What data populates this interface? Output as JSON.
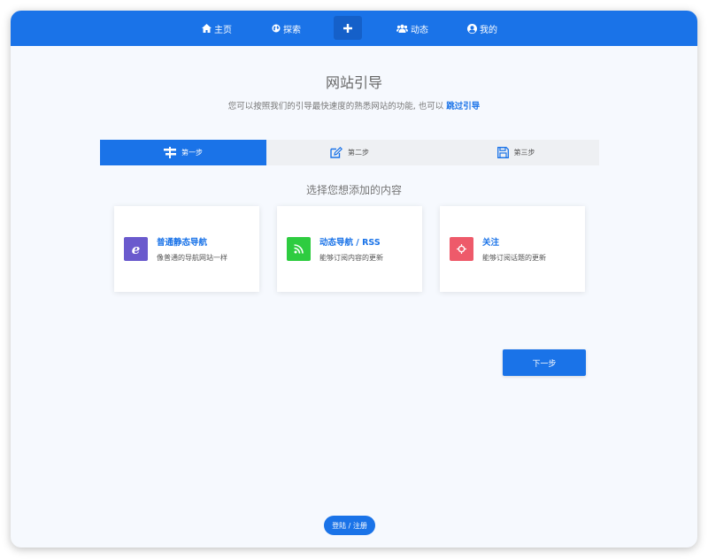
{
  "colors": {
    "primary": "#1a73e8",
    "background": "#f6f9fe",
    "card_purple": "#6a5acd",
    "card_green": "#2ecc40",
    "card_red": "#ee5a6a"
  },
  "nav": {
    "items": [
      {
        "label": "主页",
        "icon": "home-icon"
      },
      {
        "label": "探索",
        "icon": "globe-icon"
      },
      {
        "label": "",
        "icon": "plus-icon"
      },
      {
        "label": "动态",
        "icon": "users-icon"
      },
      {
        "label": "我的",
        "icon": "user-circle-icon"
      }
    ]
  },
  "header": {
    "title": "网站引导",
    "subtitle": "您可以按照我们的引导最快速度的熟悉网站的功能, 也可以",
    "skip_link": "跳过引导"
  },
  "steps": [
    {
      "label": "第一步",
      "icon": "signpost-icon",
      "active": true
    },
    {
      "label": "第二步",
      "icon": "edit-icon",
      "active": false
    },
    {
      "label": "第三步",
      "icon": "save-icon",
      "active": false
    }
  ],
  "section_title": "选择您想添加的内容",
  "cards": [
    {
      "title": "普通静态导航",
      "description": "像普通的导航网站一样",
      "icon": "ie-icon"
    },
    {
      "title": "动态导航 / RSS",
      "description": "能够订阅内容的更新",
      "icon": "rss-icon"
    },
    {
      "title": "关注",
      "description": "能够订阅话题的更新",
      "icon": "crosshair-icon"
    }
  ],
  "next_button": "下一步",
  "login_button": "登陆 / 注册"
}
